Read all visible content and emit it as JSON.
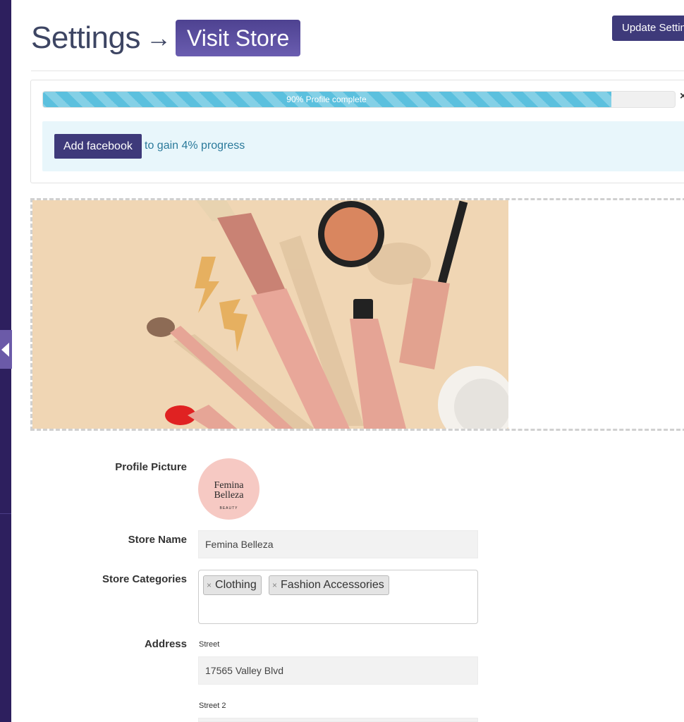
{
  "header": {
    "title": "Settings",
    "arrow": "→",
    "visit_store": "Visit Store",
    "update_button": "Update Settings"
  },
  "progress": {
    "value_percent": 90,
    "label": "90% Profile complete",
    "close": "×",
    "hint_button": "Add facebook",
    "hint_text": "to gain 4% progress"
  },
  "form": {
    "profile_picture_label": "Profile Picture",
    "avatar": {
      "line1": "Femina",
      "line2": "Belleza",
      "line3": "BEAUTY"
    },
    "store_name_label": "Store Name",
    "store_name_value": "Femina Belleza",
    "store_categories_label": "Store Categories",
    "categories": [
      {
        "remove": "×",
        "label": "Clothing"
      },
      {
        "remove": "×",
        "label": "Fashion Accessories"
      }
    ],
    "address_label": "Address",
    "street_label": "Street",
    "street_value": "17565 Valley Blvd",
    "street2_label": "Street 2",
    "street2_value": ""
  },
  "colors": {
    "sidebar": "#2d1f5e",
    "accent": "#3e3a7a",
    "progress": "#5bc0de",
    "hint_bg": "#e8f6fb",
    "hint_text": "#2b7a9b"
  }
}
